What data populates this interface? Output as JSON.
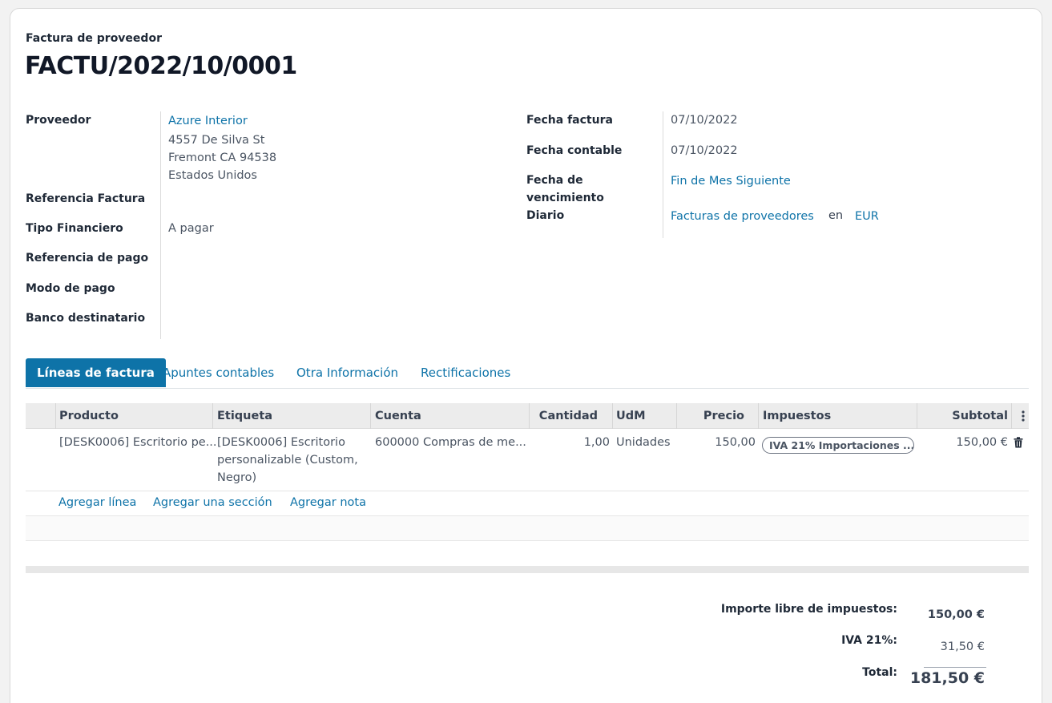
{
  "header": {
    "doc_type": "Factura de proveedor",
    "doc_name": "FACTU/2022/10/0001"
  },
  "left_fields": {
    "vendor_label": "Proveedor",
    "vendor_name": "Azure Interior",
    "vendor_street": "4557 De Silva St",
    "vendor_city": "Fremont CA 94538",
    "vendor_country": "Estados Unidos",
    "bill_ref_label": "Referencia Factura",
    "fin_type_label": "Tipo Financiero",
    "fin_type_value": "A pagar",
    "payment_ref_label": "Referencia de pago",
    "payment_mode_label": "Modo de pago",
    "bank_label": "Banco destinatario"
  },
  "right_fields": {
    "invoice_date_label": "Fecha factura",
    "invoice_date_value": "07/10/2022",
    "accounting_date_label": "Fecha contable",
    "accounting_date_value": "07/10/2022",
    "due_date_label_1": "Fecha de",
    "due_date_label_2": "vencimiento",
    "due_date_value": "Fin de Mes Siguiente",
    "journal_label": "Diario",
    "journal_value": "Facturas de proveedores",
    "journal_in": "en",
    "currency": "EUR"
  },
  "tabs": [
    {
      "label": "Líneas de factura",
      "active": true
    },
    {
      "label": "Apuntes contables"
    },
    {
      "label": "Otra Información"
    },
    {
      "label": "Rectificaciones"
    }
  ],
  "table": {
    "headers": {
      "product": "Producto",
      "label": "Etiqueta",
      "account": "Cuenta",
      "quantity": "Cantidad",
      "uom": "UdM",
      "price": "Precio",
      "taxes": "Impuestos",
      "subtotal": "Subtotal"
    },
    "rows": [
      {
        "product": "[DESK0006] Escritorio pe...",
        "label_line1": "[DESK0006] Escritorio",
        "label_line2": "personalizable (Custom,",
        "label_line3": "Negro)",
        "account": "600000 Compras de me...",
        "quantity": "1,00",
        "uom": "Unidades",
        "price": "150,00",
        "tax": "IVA 21% Importaciones ...",
        "subtotal": "150,00 €"
      }
    ],
    "add_line": "Agregar línea",
    "add_section": "Agregar una sección",
    "add_note": "Agregar nota"
  },
  "totals": {
    "untaxed_label": "Importe libre de impuestos:",
    "untaxed_value": "150,00 €",
    "tax_label": "IVA 21%:",
    "tax_value": "31,50 €",
    "total_label": "Total:",
    "total_value": "181,50 €"
  },
  "icons": {
    "row_menu": "kebab-menu-icon",
    "delete": "trash-icon"
  },
  "colors": {
    "accent": "#0e73a8",
    "header_bg": "#ececec"
  }
}
